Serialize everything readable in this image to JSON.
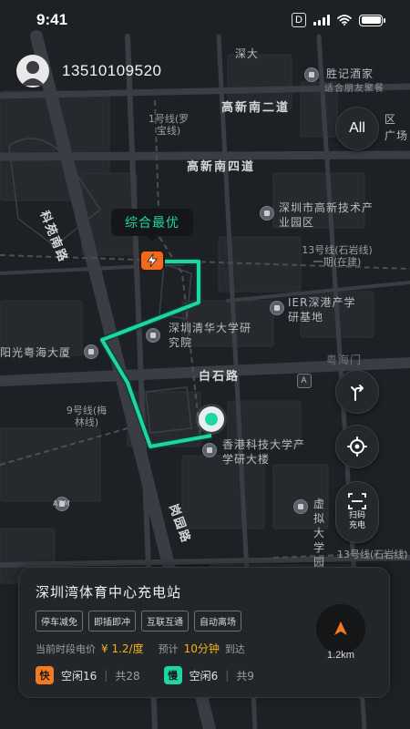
{
  "status_bar": {
    "time": "9:41",
    "badge": "D"
  },
  "user": {
    "phone": "13510109520"
  },
  "buttons": {
    "all_label": "All",
    "scan_label": "扫码充电"
  },
  "route": {
    "callout": "综合最优",
    "color": "#1fd6a2"
  },
  "map": {
    "roads": [
      "高新南二道",
      "高新南四道",
      "白石路",
      "科苑南路",
      "岗园路"
    ],
    "places": [
      "深大",
      "胜记酒家",
      "适合朋友聚餐",
      "深圳市高新技术产业园区",
      "深圳清华大学研究院",
      "IER深港产学研基地",
      "阳光粤海大厦",
      "香港科技大学产学研大楼",
      "虚拟大学园",
      "粤海门",
      "区",
      "广场",
      "ATM",
      "A"
    ],
    "metro": [
      "1号线(罗宝线)",
      "9号线(梅林线)",
      "13号线(石岩线)一期(在建)",
      "13号线(石岩线)"
    ]
  },
  "station": {
    "name": "深圳湾体育中心充电站",
    "tags": [
      "停车减免",
      "即插即冲",
      "互联互通",
      "自动离场"
    ],
    "price_label": "当前时段电价",
    "price": "¥ 1.2/度",
    "eta_label": "预计",
    "eta": "10分钟",
    "eta_suffix": "到达",
    "fast": {
      "badge": "快",
      "free": "空闲16",
      "sep": "|",
      "total": "共28"
    },
    "slow": {
      "badge": "慢",
      "free": "空闲6",
      "sep": "|",
      "total": "共9"
    },
    "distance": "1.2km"
  },
  "colors": {
    "fast": "#f37a1f",
    "slow": "#1fd6a2",
    "price": "#f5b316"
  }
}
